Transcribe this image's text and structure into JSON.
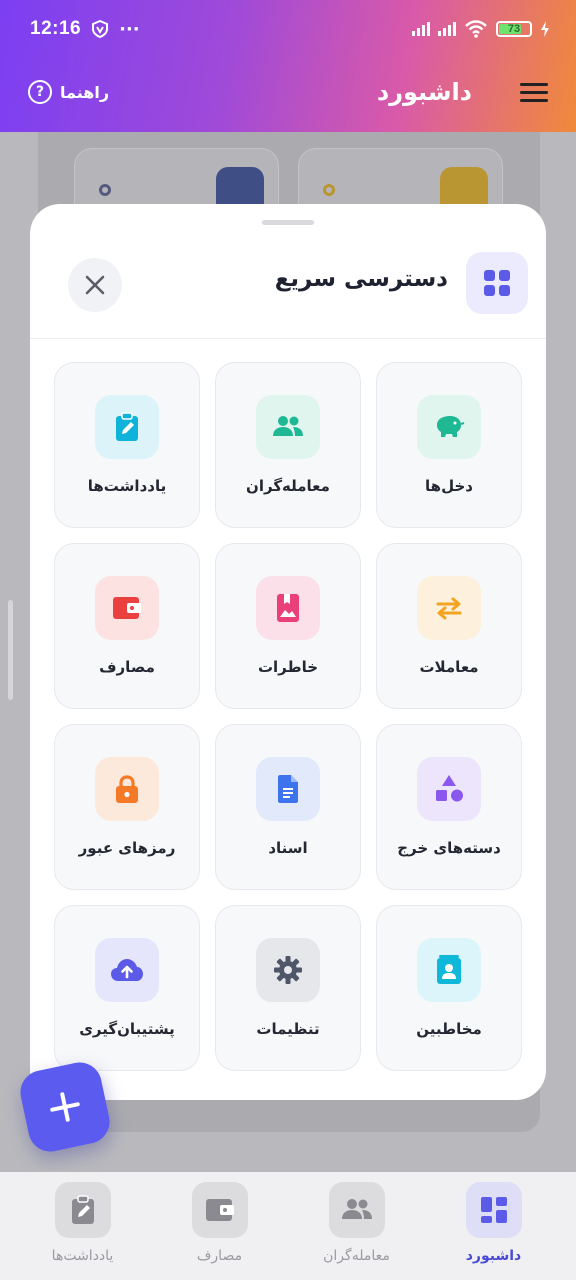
{
  "status_bar": {
    "time": "12:16",
    "dots": "···",
    "battery": "73"
  },
  "header": {
    "title": "داشبورد",
    "help_label": "راهنما"
  },
  "sheet": {
    "title": "دسترسی سریع",
    "items": [
      {
        "label": "دخل‌ها",
        "icon": "piggy-bank-icon",
        "bg": "#dff5ee",
        "fg": "#1fb894"
      },
      {
        "label": "معامله‌گران",
        "icon": "people-icon",
        "bg": "#dff5ee",
        "fg": "#1fb894"
      },
      {
        "label": "یادداشت‌ها",
        "icon": "clipboard-edit-icon",
        "bg": "#dcf3fa",
        "fg": "#0fb2d8"
      },
      {
        "label": "معاملات",
        "icon": "swap-arrows-icon",
        "bg": "#fdf0dc",
        "fg": "#f2a320"
      },
      {
        "label": "خاطرات",
        "icon": "bookmark-image-icon",
        "bg": "#fbe0ea",
        "fg": "#e9407a"
      },
      {
        "label": "مصارف",
        "icon": "wallet-icon",
        "bg": "#fde2e2",
        "fg": "#ea4040"
      },
      {
        "label": "دسته‌های خرج",
        "icon": "shapes-icon",
        "bg": "#ece5fc",
        "fg": "#8a58ee"
      },
      {
        "label": "اسناد",
        "icon": "document-icon",
        "bg": "#e1e9fb",
        "fg": "#3d74ee"
      },
      {
        "label": "رمزهای عبور",
        "icon": "lock-icon",
        "bg": "#fde9dc",
        "fg": "#f57a28"
      },
      {
        "label": "مخاطبین",
        "icon": "contact-card-icon",
        "bg": "#dcf5fb",
        "fg": "#0fb8d8"
      },
      {
        "label": "تنظیمات",
        "icon": "gear-icon",
        "bg": "#e6e7eb",
        "fg": "#4f5668"
      },
      {
        "label": "پشتیبان‌گیری",
        "icon": "cloud-upload-icon",
        "bg": "#e5e6fc",
        "fg": "#5b5be8"
      }
    ]
  },
  "bottom_nav": [
    {
      "label": "داشبورد",
      "icon": "dashboard-icon",
      "active": true
    },
    {
      "label": "معامله‌گران",
      "icon": "people-icon",
      "active": false
    },
    {
      "label": "مصارف",
      "icon": "wallet-icon",
      "active": false
    },
    {
      "label": "یادداشت‌ها",
      "icon": "clipboard-edit-icon",
      "active": false
    }
  ],
  "colors": {
    "accent": "#5b5bf0",
    "header_start": "#7b3ff2",
    "header_end": "#f08a3a"
  }
}
